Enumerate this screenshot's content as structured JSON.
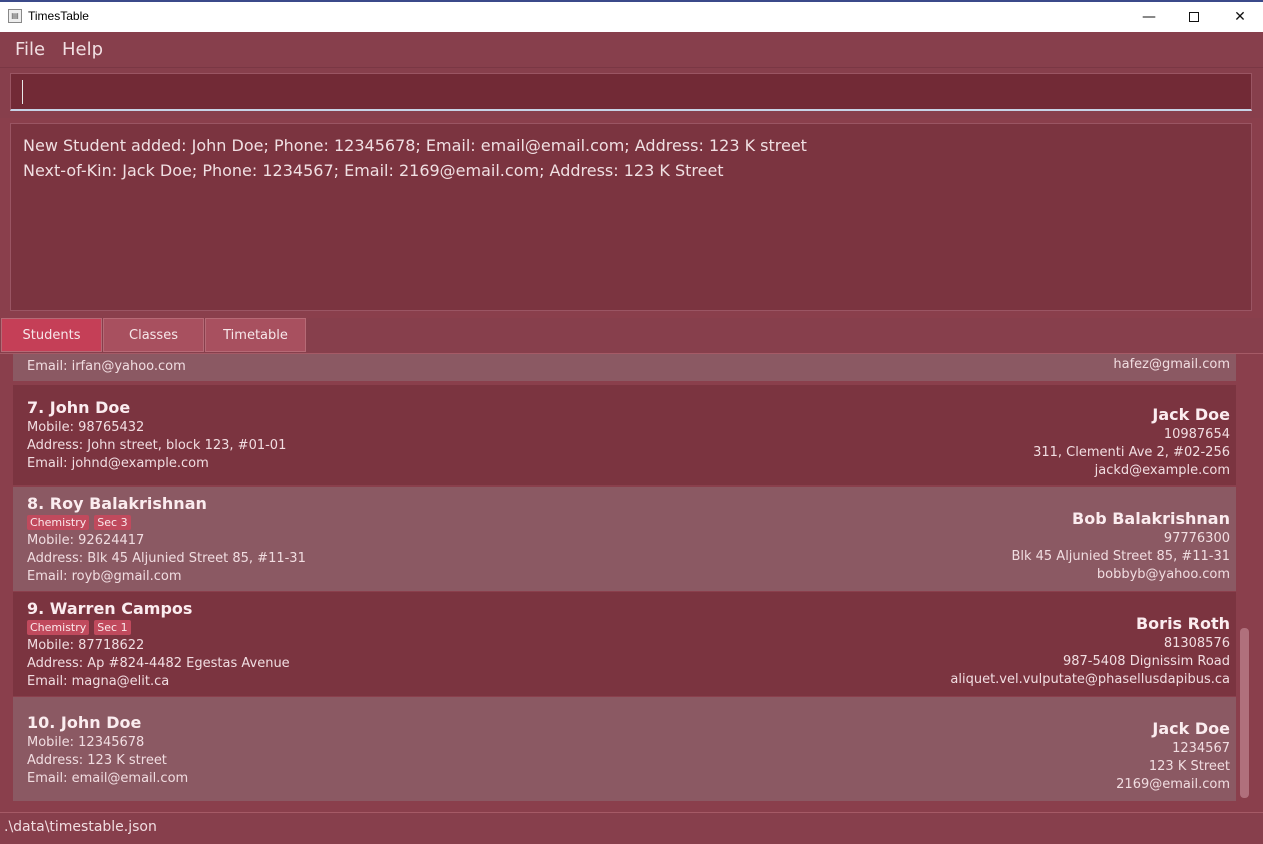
{
  "window": {
    "title": "TimesTable",
    "icon_name": "app-icon",
    "min_glyph": "—",
    "close_glyph": "✕"
  },
  "menu": {
    "file": "File",
    "help": "Help"
  },
  "command": {
    "value": "",
    "placeholder": ""
  },
  "result": {
    "line1": "New Student added: John  Doe; Phone: 12345678; Email: email@email.com; Address: 123 K street",
    "line2": "Next-of-Kin: Jack Doe; Phone: 1234567; Email: 2169@email.com; Address: 123 K Street"
  },
  "tabs": {
    "students": "Students",
    "classes": "Classes",
    "timetable": "Timetable"
  },
  "students": [
    {
      "email": "Email: irfan@yahoo.com",
      "kin_email": "hafez@gmail.com"
    },
    {
      "name": "7.  John Doe",
      "mobile": "Mobile: 98765432",
      "address": "Address: John street, block 123, #01-01",
      "email": "Email: johnd@example.com",
      "kin_name": "Jack Doe",
      "kin_phone": "10987654",
      "kin_address": "311, Clementi Ave 2, #02-256",
      "kin_email": "jackd@example.com"
    },
    {
      "name": "8.  Roy Balakrishnan",
      "tags": [
        "Chemistry",
        "Sec 3"
      ],
      "mobile": "Mobile: 92624417",
      "address": "Address: Blk 45 Aljunied Street 85, #11-31",
      "email": "Email: royb@gmail.com",
      "kin_name": "Bob Balakrishnan",
      "kin_phone": "97776300",
      "kin_address": "Blk 45 Aljunied Street 85, #11-31",
      "kin_email": "bobbyb@yahoo.com"
    },
    {
      "name": "9.  Warren Campos",
      "tags": [
        "Chemistry",
        "Sec 1"
      ],
      "mobile": "Mobile: 87718622",
      "address": "Address: Ap #824-4482 Egestas Avenue",
      "email": "Email: magna@elit.ca",
      "kin_name": "Boris Roth",
      "kin_phone": "81308576",
      "kin_address": "987-5408 Dignissim Road",
      "kin_email": "aliquet.vel.vulputate@phasellusdapibus.ca"
    },
    {
      "name": "10.  John  Doe",
      "mobile": "Mobile: 12345678",
      "address": "Address: 123 K street",
      "email": "Email: email@email.com",
      "kin_name": "Jack Doe",
      "kin_phone": "1234567",
      "kin_address": "123 K Street",
      "kin_email": "2169@email.com"
    }
  ],
  "status": {
    "path": ".\\data\\timestable.json"
  },
  "colors": {
    "background": "#8a3f4c",
    "card": "#7b3440",
    "card_alt": "#8b5963",
    "tag": "#c04a5d",
    "tab_active": "#c53f57",
    "tab": "#a8505f"
  }
}
